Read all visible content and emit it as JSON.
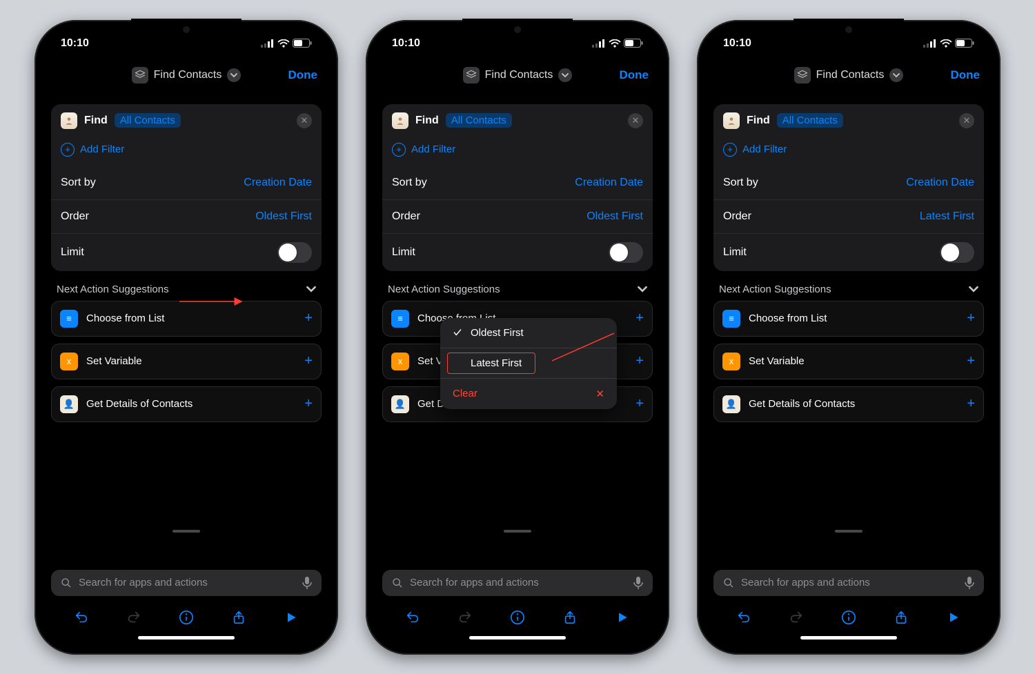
{
  "status": {
    "time": "10:10"
  },
  "nav": {
    "title": "Find Contacts",
    "done": "Done"
  },
  "find": {
    "label": "Find",
    "chip": "All Contacts"
  },
  "addFilter": "Add Filter",
  "rows": {
    "sortBy": {
      "label": "Sort by",
      "value": "Creation Date"
    },
    "order": {
      "label": "Order"
    },
    "limit": {
      "label": "Limit"
    }
  },
  "orderValues": {
    "oldest": "Oldest First",
    "latest": "Latest First"
  },
  "search": {
    "placeholder": "Search for apps and actions"
  },
  "section": {
    "title": "Next Action Suggestions"
  },
  "suggestions": [
    {
      "label": "Choose from List",
      "color": "#0a84ff",
      "glyph": "≡"
    },
    {
      "label": "Set Variable",
      "color": "#ff9500",
      "glyph": "x"
    },
    {
      "label": "Get Details of Contacts",
      "color": "#f2e9db",
      "glyph": "👤"
    }
  ],
  "popup": {
    "opt1": "Oldest First",
    "opt2": "Latest First",
    "clear": "Clear"
  },
  "phones": [
    {
      "orderKey": "oldest",
      "showPopup": false,
      "showArrow1": true,
      "showArrow2": false
    },
    {
      "orderKey": "oldest",
      "showPopup": true,
      "showArrow1": false,
      "showArrow2": true
    },
    {
      "orderKey": "latest",
      "showPopup": false,
      "showArrow1": false,
      "showArrow2": false
    }
  ]
}
